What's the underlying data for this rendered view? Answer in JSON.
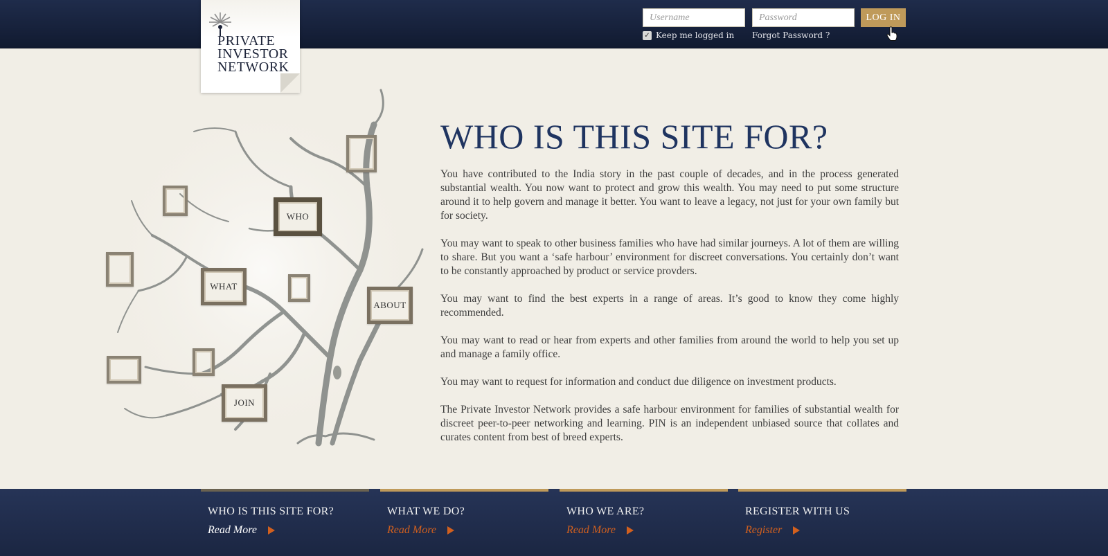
{
  "logo": {
    "lines": [
      "PRIVATE",
      "INVESTOR",
      "NETWORK"
    ]
  },
  "login": {
    "username_placeholder": "Username",
    "password_placeholder": "Password",
    "login_label": "LOG IN",
    "remember_label": "Keep me logged in",
    "remember_checked": true,
    "forgot_label": "Forgot Password ?"
  },
  "tree": {
    "frames": [
      "WHO",
      "WHAT",
      "ABOUT",
      "JOIN"
    ]
  },
  "main": {
    "heading": "WHO IS THIS SITE FOR?",
    "paragraphs": [
      "You have contributed to the India story in the past couple of decades, and in the process generated substantial wealth. You now want to protect and grow this wealth. You may need to put some structure around it to help govern and manage it better. You want to leave a legacy, not just for your own family but for society.",
      "You may want to speak to other business families who have had similar journeys. A lot of them are willing to share. But you want a ‘safe harbour’ environment for discreet conversations. You certainly don’t want to be constantly approached by product or service provders.",
      "You may want to find the best experts in a range of areas. It’s good to know they come highly recommended.",
      "You may want to read or hear from experts and other families from around the world to help you set up and manage a family office.",
      "You may want to request for information and conduct due diligence on investment products.",
      "The Private Investor Network provides a safe harbour environment for families of substantial wealth for discreet peer-to-peer networking and learning. PIN is an independent unbiased source that collates and curates content from best of breed experts."
    ]
  },
  "footer": {
    "columns": [
      {
        "title": "WHO IS THIS SITE FOR?",
        "link": "Read More"
      },
      {
        "title": "WHAT WE DO?",
        "link": "Read More"
      },
      {
        "title": "WHO WE ARE?",
        "link": "Read More"
      },
      {
        "title": "REGISTER WITH US",
        "link": "Register"
      }
    ]
  },
  "colors": {
    "navy": "#1f3460",
    "gold": "#bf9a5a",
    "orange": "#d2601e",
    "background": "#f1eee6"
  }
}
